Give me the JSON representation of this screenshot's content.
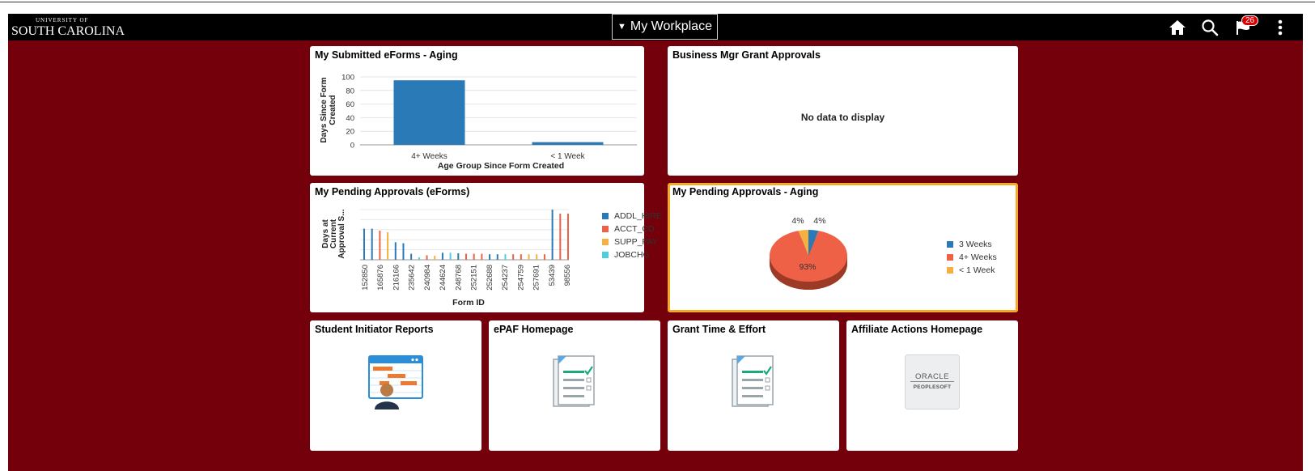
{
  "header": {
    "logo_small": "UNIVERSITY OF",
    "logo_big": "SOUTH CAROLINA",
    "title": "My Workplace",
    "notification_count": "26",
    "icons": [
      "home-icon",
      "search-icon",
      "notification-flag-icon",
      "actions-menu-icon"
    ]
  },
  "colors": {
    "header_bg": "#000000",
    "page_bg": "#73000a",
    "tile_bg": "#ffffff",
    "selected_border": "#f4aa27",
    "series_blue": "#2a7ab8",
    "series_red": "#ee6146",
    "series_orange": "#f6b042",
    "series_teal": "#4fd0d8"
  },
  "tiles": {
    "submitted": {
      "title": "My Submitted eForms - Aging",
      "chart": {
        "type": "bar",
        "categories": [
          "4+ Weeks",
          "< 1 Week"
        ],
        "values": [
          95,
          4
        ],
        "ylim": [
          0,
          100
        ],
        "yticks": [
          "0",
          "20",
          "40",
          "60",
          "80",
          "100"
        ],
        "ylabel_line1": "Days Since Form",
        "ylabel_line2": "Created",
        "xlabel": "Age Group Since Form Created"
      }
    },
    "grant": {
      "title": "Business Mgr Grant Approvals",
      "nodata": "No data to display"
    },
    "pending": {
      "title": "My Pending Approvals (eForms)",
      "chart": {
        "type": "bar",
        "xlabel": "Form ID",
        "ylabel_line1": "Days at",
        "ylabel_line2": "Current",
        "ylabel_line3": "Approval S...",
        "categories": [
          "152850",
          "165876",
          "216166",
          "235642",
          "240984",
          "244624",
          "248768",
          "252151",
          "252688",
          "254237",
          "254759",
          "257691",
          "53439",
          "98556"
        ],
        "legend": [
          "ADDL_HIRE",
          "ACCT_CD",
          "SUPP_PAY",
          "JOBCHG"
        ],
        "ymax": 100,
        "bars": [
          {
            "s": 0,
            "v": 62
          },
          {
            "s": 0,
            "v": 62
          },
          {
            "s": 1,
            "v": 58
          },
          {
            "s": 2,
            "v": 55
          },
          {
            "s": 0,
            "v": 35
          },
          {
            "s": 0,
            "v": 33
          },
          {
            "s": 0,
            "v": 12
          },
          {
            "s": 3,
            "v": 5
          },
          {
            "s": 1,
            "v": 9
          },
          {
            "s": 2,
            "v": 8
          },
          {
            "s": 0,
            "v": 14
          },
          {
            "s": 3,
            "v": 14
          },
          {
            "s": 0,
            "v": 13
          },
          {
            "s": 1,
            "v": 12
          },
          {
            "s": 1,
            "v": 12
          },
          {
            "s": 1,
            "v": 12
          },
          {
            "s": 0,
            "v": 11
          },
          {
            "s": 0,
            "v": 11
          },
          {
            "s": 3,
            "v": 11
          },
          {
            "s": 1,
            "v": 11
          },
          {
            "s": 1,
            "v": 11
          },
          {
            "s": 2,
            "v": 11
          },
          {
            "s": 2,
            "v": 11
          },
          {
            "s": 1,
            "v": 11
          },
          {
            "s": 0,
            "v": 100
          },
          {
            "s": 1,
            "v": 92
          },
          {
            "s": 1,
            "v": 92
          }
        ],
        "bar_positions": [
          0,
          1,
          2,
          3,
          4,
          5,
          6,
          7,
          8,
          9,
          10,
          11,
          12,
          13,
          14,
          15,
          16,
          17,
          18,
          19,
          20,
          21,
          22,
          23,
          24,
          25,
          26
        ]
      }
    },
    "aging": {
      "title": "My Pending Approvals - Aging",
      "chart": {
        "type": "pie",
        "labels": [
          "3 Weeks",
          "4+ Weeks",
          "< 1 Week"
        ],
        "values": [
          4,
          93,
          4
        ],
        "label_3weeks": "4%",
        "label_1week": "4%",
        "label_4plus": "93%"
      }
    },
    "student": {
      "title": "Student Initiator Reports"
    },
    "epaf": {
      "title": "ePAF Homepage"
    },
    "grant_time": {
      "title": "Grant Time & Effort"
    },
    "affiliate": {
      "title": "Affiliate Actions Homepage",
      "logo_line1": "ORACLE",
      "logo_line2": "PEOPLESOFT"
    }
  }
}
